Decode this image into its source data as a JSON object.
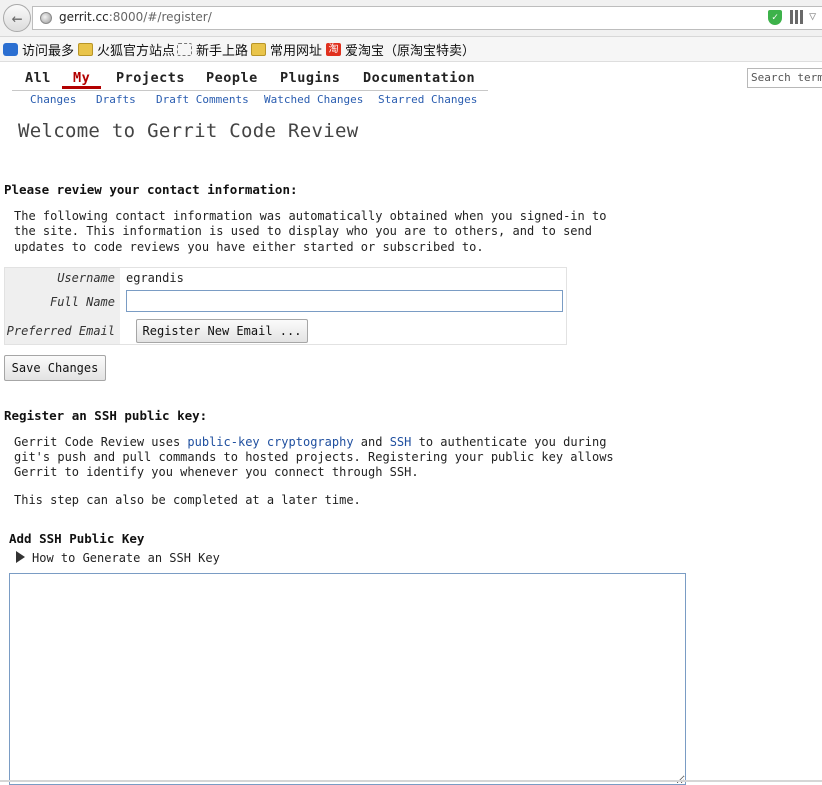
{
  "browser": {
    "url_host": "gerrit.cc",
    "url_rest": ":8000/#/register/",
    "bookmarks": [
      {
        "label": "访问最多",
        "icon": "search-icon"
      },
      {
        "label": "火狐官方站点",
        "icon": "folder-icon"
      },
      {
        "label": "新手上路",
        "icon": "page-icon"
      },
      {
        "label": "常用网址",
        "icon": "folder-icon"
      },
      {
        "label": "爱淘宝（原淘宝特卖）",
        "icon": "taobao-icon",
        "icon_text": "淘"
      }
    ]
  },
  "topmenu": {
    "items": [
      "All",
      "My",
      "Projects",
      "People",
      "Plugins",
      "Documentation"
    ],
    "active": "My",
    "subitems": [
      "Changes",
      "Drafts",
      "Draft Comments",
      "Watched Changes",
      "Starred Changes"
    ],
    "search_placeholder": "Search term"
  },
  "main": {
    "title": "Welcome to Gerrit Code Review",
    "contact": {
      "heading": "Please review your contact information:",
      "intro": "The following contact information was automatically obtained when you signed-in to\nthe site. This information is used to display who you are to others, and to send\nupdates to code reviews you have either started or subscribed to.",
      "labels": {
        "username": "Username",
        "full_name": "Full Name",
        "preferred_email": "Preferred Email"
      },
      "username": "egrandis",
      "full_name": "",
      "register_email_button": "Register New Email ...",
      "save_button": "Save Changes"
    },
    "ssh": {
      "heading": "Register an SSH public key:",
      "intro_part1": "Gerrit Code Review uses ",
      "link_pk": "public-key cryptography",
      "intro_part2": " and ",
      "link_ssh": "SSH",
      "intro_part3": " to authenticate you during",
      "intro_line2": "git's push and pull commands to hosted projects. Registering your public key allows",
      "intro_line3": "Gerrit to identify you whenever you connect through SSH.",
      "later_note": "This step can also be completed at a later time.",
      "add_key_heading": "Add SSH Public Key",
      "howto_label": "How to Generate an SSH Key",
      "key_text": ""
    }
  }
}
